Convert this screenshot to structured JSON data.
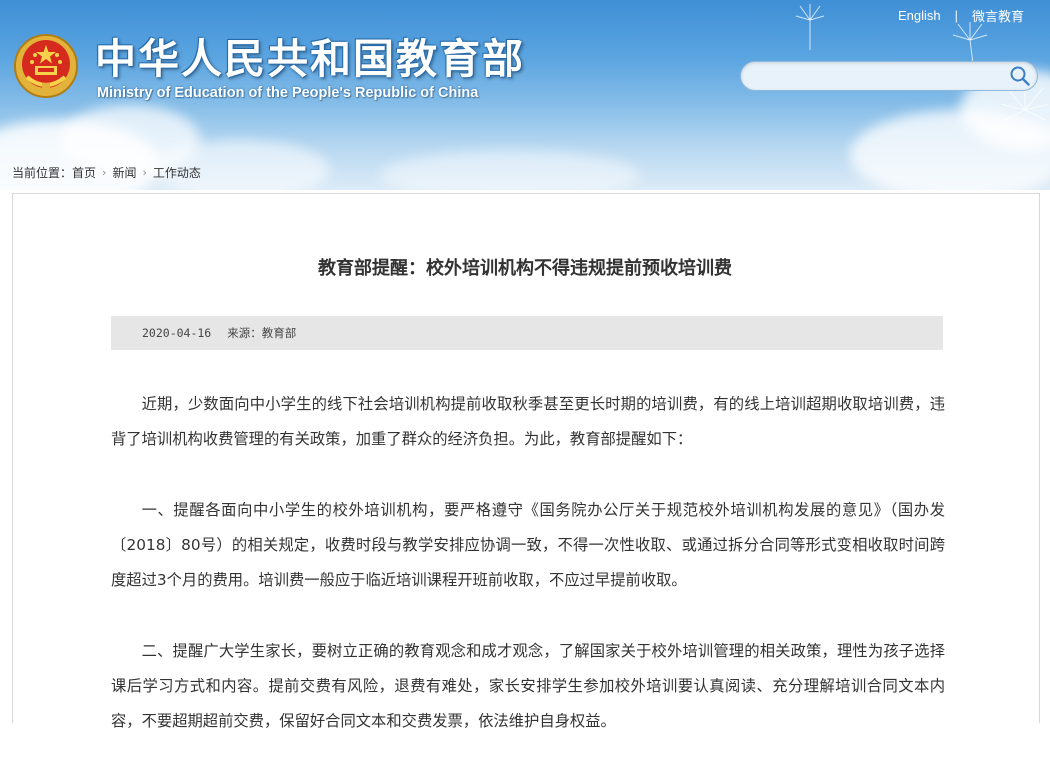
{
  "header": {
    "title_cn": "中华人民共和国教育部",
    "title_en": "Ministry of Education of the People's Republic of China",
    "links": {
      "english": "English",
      "separator": "|",
      "weibo": "微言教育"
    },
    "search": {
      "placeholder": "",
      "value": ""
    }
  },
  "breadcrumb": {
    "label": "当前位置：",
    "items": [
      "首页",
      "新闻",
      "工作动态"
    ]
  },
  "article": {
    "title": "教育部提醒：校外培训机构不得违规提前预收培训费",
    "date": "2020-04-16",
    "source": "来源：教育部",
    "paragraphs": [
      "近期，少数面向中小学生的线下社会培训机构提前收取秋季甚至更长时期的培训费，有的线上培训超期收取培训费，违背了培训机构收费管理的有关政策，加重了群众的经济负担。为此，教育部提醒如下：",
      "一、提醒各面向中小学生的校外培训机构，要严格遵守《国务院办公厅关于规范校外培训机构发展的意见》（国办发〔2018〕80号）的相关规定，收费时段与教学安排应协调一致，不得一次性收取、或通过拆分合同等形式变相收取时间跨度超过3个月的费用。培训费一般应于临近培训课程开班前收取，不应过早提前收取。",
      "二、提醒广大学生家长，要树立正确的教育观念和成才观念，了解国家关于校外培训管理的相关政策，理性为孩子选择课后学习方式和内容。提前交费有风险，退费有难处，家长安排学生参加校外培训要认真阅读、充分理解培训合同文本内容，不要超期超前交费，保留好合同文本和交费发票，依法维护自身权益。"
    ]
  },
  "colors": {
    "header_blue": "#3f8fd6",
    "meta_bar": "#e6e6e6",
    "text": "#333333"
  }
}
